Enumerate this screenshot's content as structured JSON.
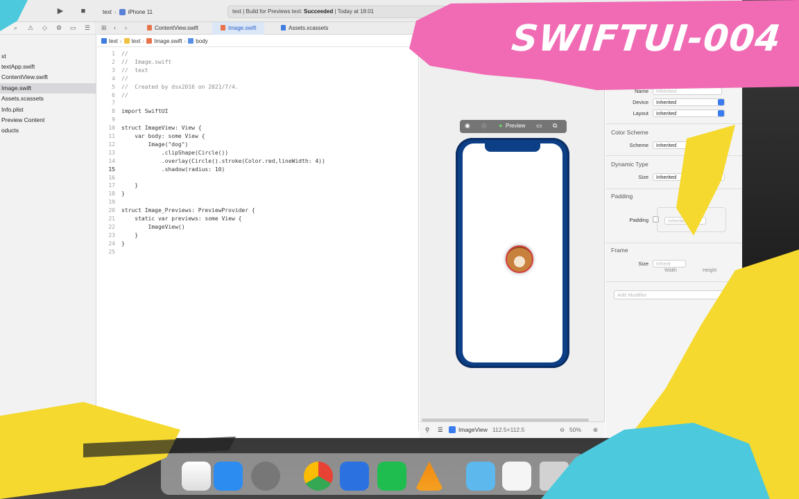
{
  "toolbar": {
    "scheme_project": "text",
    "scheme_device": "iPhone 11",
    "status_prefix": "text | Build for Previews text: ",
    "status_result": "Succeeded",
    "status_time": " | Today at 18:01",
    "warning_count": "1"
  },
  "navigator": {
    "items": [
      {
        "label": "xt"
      },
      {
        "label": "textApp.swift"
      },
      {
        "label": "ContentView.swift"
      },
      {
        "label": "Image.swift"
      },
      {
        "label": "Assets.xcassets"
      },
      {
        "label": "Info.plist"
      },
      {
        "label": "Preview Content"
      },
      {
        "label": "oducts"
      }
    ],
    "selected_index": 3
  },
  "editor": {
    "tabs": [
      {
        "label": "ContentView.swift"
      },
      {
        "label": "Image.swift"
      },
      {
        "label": "Assets.xcassets"
      }
    ],
    "active_tab_index": 1,
    "jumpbar": [
      "text",
      "text",
      "Image.swift",
      "body"
    ],
    "current_line": 15,
    "code_lines": [
      "//",
      "//  Image.swift",
      "//  text",
      "//",
      "//  Created by dsx2016 on 2021/7/4.",
      "//",
      "",
      "import SwiftUI",
      "",
      "struct ImageView: View {",
      "    var body: some View {",
      "        Image(\"dog\")",
      "            .clipShape(Circle())",
      "            .overlay(Circle().stroke(Color.red,lineWidth: 4))",
      "            .shadow(radius: 10)",
      "        ",
      "    }",
      "}",
      "",
      "struct Image_Previews: PreviewProvider {",
      "    static var previews: some View {",
      "        ImageView()",
      "    }",
      "}",
      ""
    ]
  },
  "canvas": {
    "preview_button_label": "Preview",
    "view_name": "ImageView",
    "view_size": "112.5×112.5",
    "zoom": "50%"
  },
  "inspector": {
    "name_label": "Name",
    "name_value": "Inherited",
    "device_label": "Device",
    "device_value": "Inherited",
    "layout_label": "Layout",
    "layout_value": "Inherited",
    "color_scheme_header": "Color Scheme",
    "scheme_label": "Scheme",
    "scheme_value": "Inherited",
    "dynamic_type_header": "Dynamic Type",
    "size_label": "Size",
    "size_value": "Inherited",
    "padding_header": "Padding",
    "padding_label": "Padding",
    "padding_value": "Inherited",
    "frame_header": "Frame",
    "frame_size_label": "Size",
    "frame_width_value": "Inherit",
    "frame_width_caption": "Width",
    "frame_height_caption": "Height",
    "add_modifier_placeholder": "Add Modifier"
  },
  "overlay": {
    "title": "SWIFTUI-004"
  },
  "colors": {
    "pink": "#f06bb4",
    "yellow": "#f5d92e",
    "cyan": "#4cc9dc",
    "phone_blue": "#0c3f86",
    "accent_blue": "#2b62c8"
  },
  "dock": {
    "icons": [
      "reminders-icon",
      "app-store-icon",
      "system-preferences-icon",
      "chrome-icon",
      "word-icon",
      "wechat-icon",
      "vlc-icon",
      "downloads-folder-icon",
      "wechat-window-icon",
      "trash-icon"
    ]
  }
}
